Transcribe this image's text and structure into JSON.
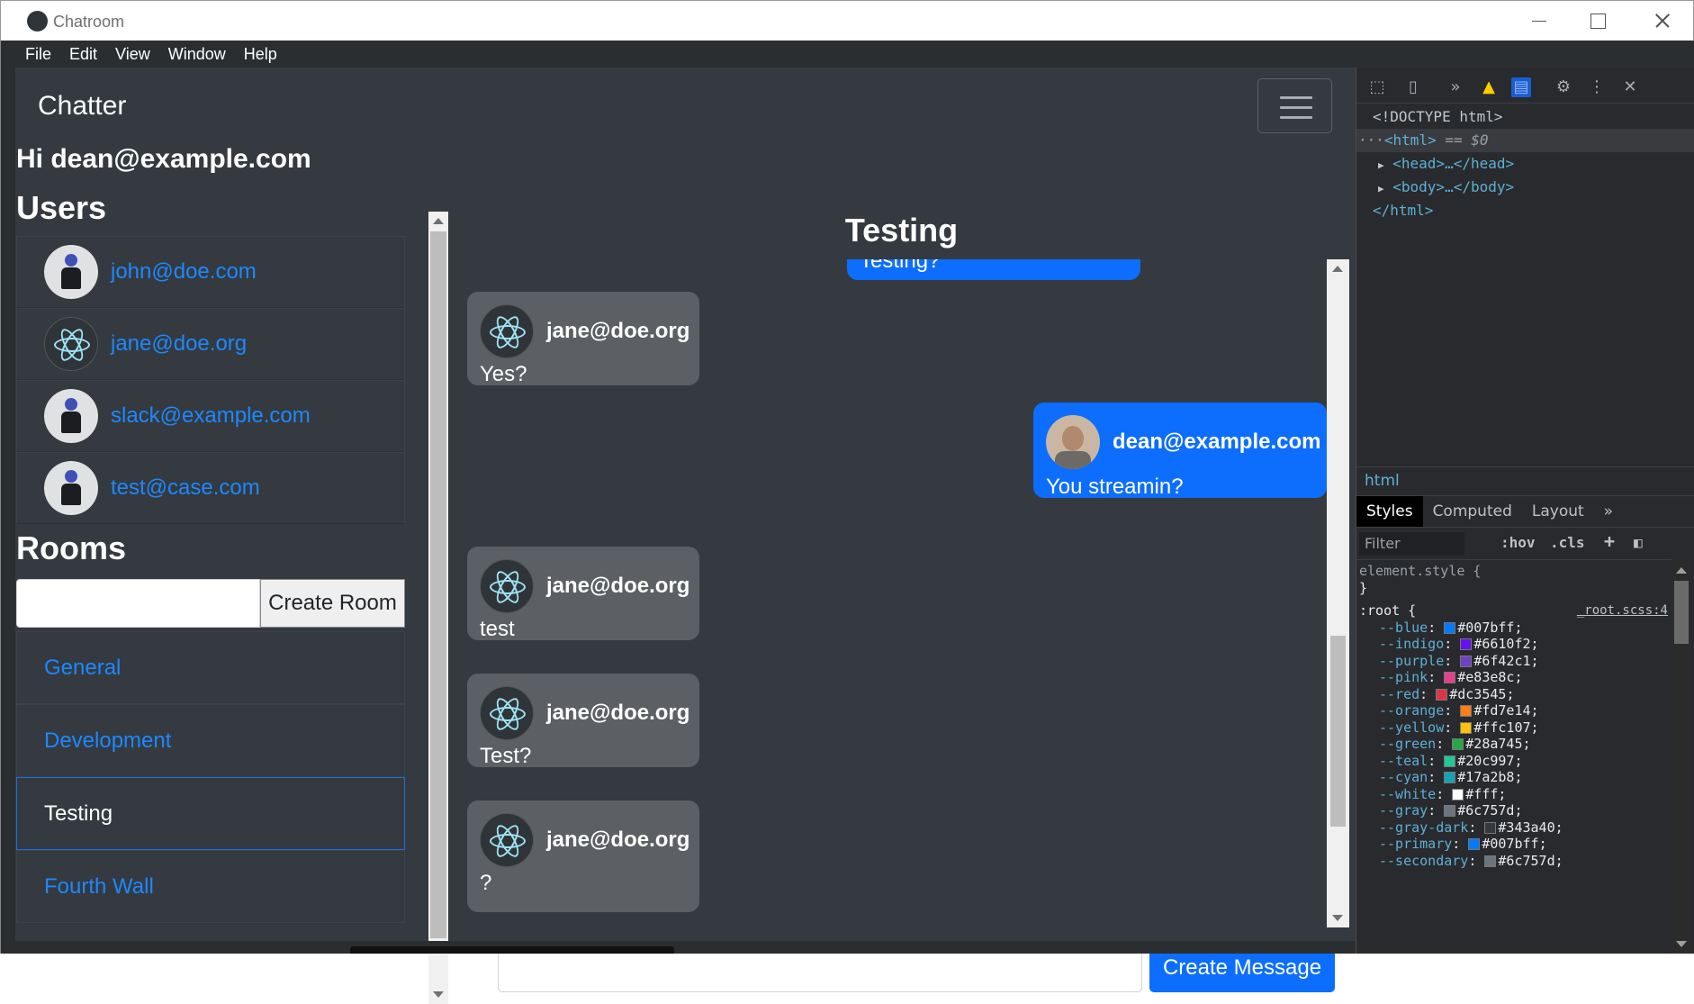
{
  "window": {
    "title": "Chatroom",
    "menu": [
      "File",
      "Edit",
      "View",
      "Window",
      "Help"
    ]
  },
  "app": {
    "brand": "Chatter",
    "greeting": "Hi dean@example.com",
    "users_heading": "Users",
    "users": [
      {
        "name": "john@doe.com",
        "avatar": "default-avatar"
      },
      {
        "name": "jane@doe.org",
        "avatar": "electron-avatar"
      },
      {
        "name": "slack@example.com",
        "avatar": "default-avatar"
      },
      {
        "name": "test@case.com",
        "avatar": "default-avatar"
      }
    ],
    "rooms_heading": "Rooms",
    "room_input_value": "",
    "create_room_label": "Create Room",
    "rooms": [
      {
        "name": "General",
        "active": false
      },
      {
        "name": "Development",
        "active": false
      },
      {
        "name": "Testing",
        "active": true
      },
      {
        "name": "Fourth Wall",
        "active": false
      }
    ],
    "current_room": "Testing",
    "messages": [
      {
        "from": "",
        "text": "Testing?",
        "self": true
      },
      {
        "from": "jane@doe.org",
        "text": "Yes?",
        "self": false
      },
      {
        "from": "dean@example.com",
        "text": "You streamin?",
        "self": true
      },
      {
        "from": "jane@doe.org",
        "text": "test",
        "self": false
      },
      {
        "from": "jane@doe.org",
        "text": "Test?",
        "self": false
      },
      {
        "from": "jane@doe.org",
        "text": "?",
        "self": false
      }
    ],
    "message_input_value": "",
    "create_message_label": "Create Message",
    "colors": {
      "primary": "#007bff",
      "background": "#343a40",
      "other_bubble": "#5c5f63"
    }
  },
  "devtools": {
    "dom": {
      "doctype": "<!DOCTYPE html>",
      "html_open": "<html>",
      "selected_marker": "== $0",
      "head": "<head>…</head>",
      "body": "<body>…</body>",
      "html_close": "</html>"
    },
    "breadcrumb": "html",
    "tabs": [
      "Styles",
      "Computed",
      "Layout",
      "»"
    ],
    "filter_placeholder": "Filter",
    "hov": ":hov",
    "cls": ".cls",
    "element_style_open": "element.style {",
    "element_style_close": "}",
    "root_selector": ":root {",
    "root_source": "_root.scss:4",
    "variables": [
      {
        "name": "--blue",
        "value": "#007bff"
      },
      {
        "name": "--indigo",
        "value": "#6610f2"
      },
      {
        "name": "--purple",
        "value": "#6f42c1"
      },
      {
        "name": "--pink",
        "value": "#e83e8c"
      },
      {
        "name": "--red",
        "value": "#dc3545"
      },
      {
        "name": "--orange",
        "value": "#fd7e14"
      },
      {
        "name": "--yellow",
        "value": "#ffc107"
      },
      {
        "name": "--green",
        "value": "#28a745"
      },
      {
        "name": "--teal",
        "value": "#20c997"
      },
      {
        "name": "--cyan",
        "value": "#17a2b8"
      },
      {
        "name": "--white",
        "value": "#fff"
      },
      {
        "name": "--gray",
        "value": "#6c757d"
      },
      {
        "name": "--gray-dark",
        "value": "#343a40"
      },
      {
        "name": "--primary",
        "value": "#007bff"
      },
      {
        "name": "--secondary",
        "value": "#6c757d"
      }
    ]
  }
}
